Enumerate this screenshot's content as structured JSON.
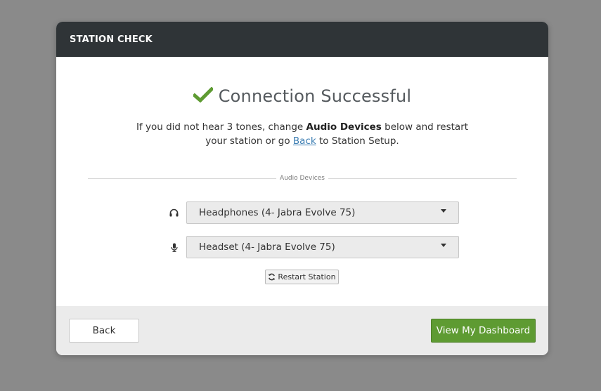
{
  "header": {
    "title": "STATION CHECK"
  },
  "status": {
    "icon": "checkmark-icon",
    "text": "Connection Successful",
    "color": "#5e9b32"
  },
  "message": {
    "part1": "If you did not hear 3 tones, change ",
    "bold": "Audio Devices",
    "part2": " below and restart",
    "part3": "your station or go ",
    "link": "Back",
    "part4": " to Station Setup."
  },
  "audio_devices": {
    "section_label": "Audio Devices",
    "output": {
      "icon": "headphones-icon",
      "selected": "Headphones (4- Jabra Evolve 75)"
    },
    "input": {
      "icon": "microphone-icon",
      "selected": "Headset (4- Jabra Evolve 75)"
    },
    "restart_label": "Restart Station",
    "restart_icon": "refresh-icon"
  },
  "footer": {
    "back_label": "Back",
    "dashboard_label": "View My Dashboard",
    "dashboard_color": "#5e9b32"
  },
  "colors": {
    "header_bg": "#2f3437",
    "link": "#3e7fb3",
    "backdrop": "#8a8a8a"
  }
}
